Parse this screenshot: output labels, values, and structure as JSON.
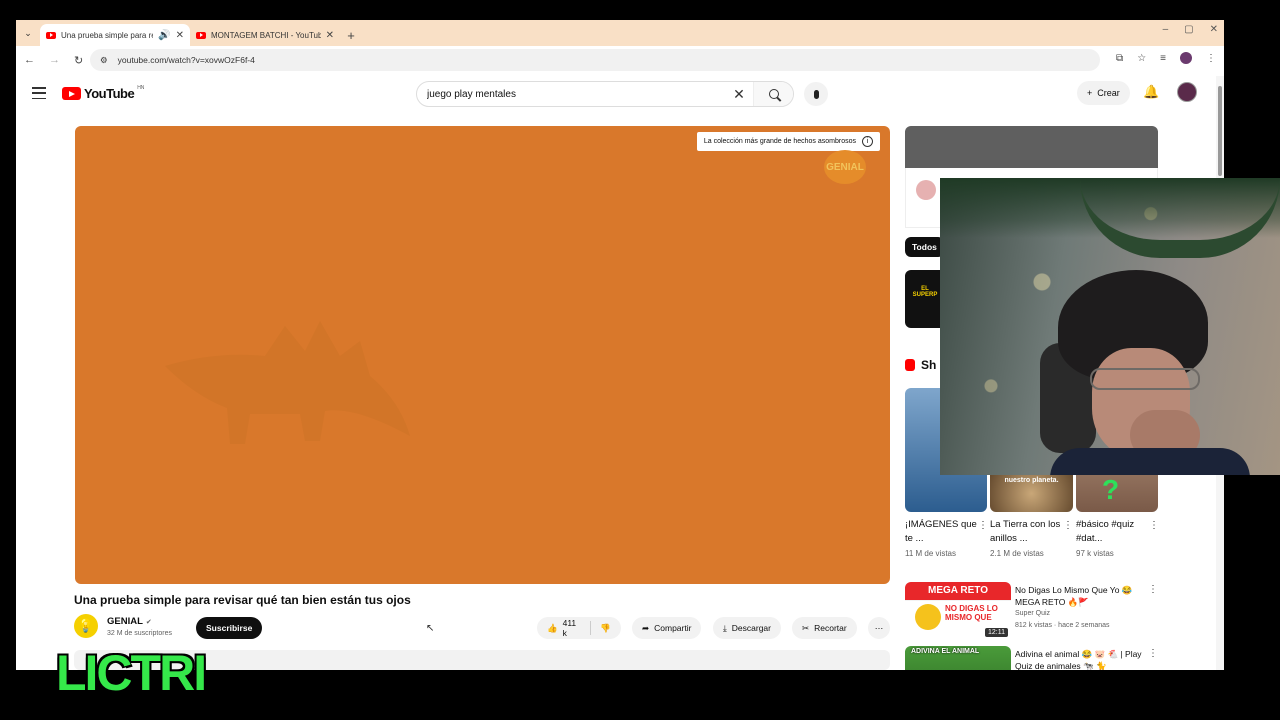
{
  "browser": {
    "tabs": [
      {
        "title": "Una prueba simple para rev",
        "active": true
      },
      {
        "title": "MONTAGEM BATCHI - YouTube",
        "active": false
      }
    ],
    "url": "youtube.com/watch?v=xovwOzF6f-4",
    "window_controls": [
      "–",
      "▢",
      "✕"
    ]
  },
  "masthead": {
    "logo_text": "YouTube",
    "country_code": "HN",
    "search_value": "juego play mentales",
    "create_label": "Crear"
  },
  "player": {
    "badge_text": "La colección más grande de hechos asombrosos",
    "watermark": "GENIAL",
    "background_color": "#d9782b"
  },
  "video": {
    "title": "Una prueba simple para revisar qué tan bien están tus ojos",
    "channel": "GENIAL",
    "subscribers": "32 M de suscriptores",
    "subscribe_label": "Suscribirse",
    "likes": "411 k",
    "share_label": "Compartir",
    "download_label": "Descargar",
    "clip_label": "Recortar"
  },
  "sidebar": {
    "chip_all": "Todos",
    "shorts_heading": "Sh",
    "shorts": [
      {
        "title": "¡IMÁGENES que te ...",
        "views": "11 M de vistas",
        "caption": ""
      },
      {
        "title": "La Tierra con los anillos ...",
        "views": "2.1 M de vistas",
        "caption": "nuestro planeta."
      },
      {
        "title": "#básico #quiz #dat...",
        "views": "97 k vistas",
        "caption": ""
      }
    ],
    "recommendations": [
      {
        "title": "No Digas Lo Mismo Que Yo 😂 MEGA RETO 🔥🚩",
        "channel": "Super Quiz",
        "stats": "812 k vistas · hace 2 semanas",
        "duration": "12:11",
        "thumb_banner": "MEGA RETO",
        "thumb_text": "NO DIGAS LO MISMO QUE"
      },
      {
        "title": "Adivina el animal 😂 🐷 🐔 | Play Quiz de animales 🐄 🐈",
        "channel": "",
        "stats": "",
        "duration": "",
        "thumb_banner": "ADIVINA EL ANIMAL",
        "thumb_text": ""
      }
    ]
  },
  "overlay": {
    "streamer_name": "LICTRI"
  },
  "colors": {
    "youtube_red": "#ff0000",
    "tab_strip": "#f9e0c6",
    "overlay_green": "#35e84a"
  }
}
